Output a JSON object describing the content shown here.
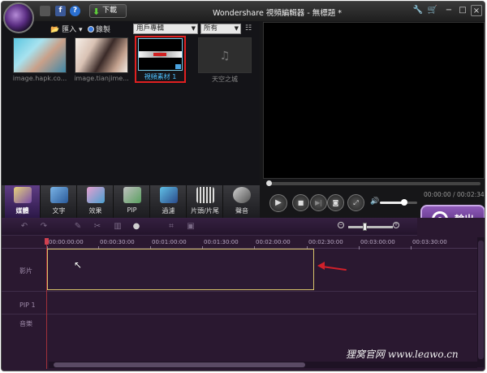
{
  "window": {
    "title": "Wondershare 視頻編輯器 - 無標題 *"
  },
  "titlebar": {
    "facebook_icon": "f",
    "help_icon": "?",
    "download_label": "下載",
    "settings_icon": "wrench-icon",
    "cart_icon": "cart-icon",
    "minimize": "−",
    "maximize": "□",
    "close": "×"
  },
  "library": {
    "import_label": "匯入",
    "record_label": "錄製",
    "album_select": "用戶專輯",
    "filter_select": "所有",
    "items": [
      {
        "caption": "image.hapk.co..."
      },
      {
        "caption": "image.tianjime..."
      },
      {
        "caption": "視頻素材 1",
        "selected": true
      },
      {
        "caption": "天空之城"
      }
    ]
  },
  "tabs": [
    {
      "label": "媒體",
      "active": true
    },
    {
      "label": "文字"
    },
    {
      "label": "效果"
    },
    {
      "label": "PIP"
    },
    {
      "label": "過濾"
    },
    {
      "label": "片頭/片尾"
    },
    {
      "label": "聲音"
    }
  ],
  "player": {
    "timecode": "00:00:00 / 00:02:34",
    "volume_level": 0.65
  },
  "export": {
    "label": "輸出"
  },
  "timeline": {
    "ruler": [
      "00:00:00:00",
      "00:00:30:00",
      "00:01:00:00",
      "00:01:30:00",
      "00:02:00:00",
      "00:02:30:00",
      "00:03:00:00",
      "00:03:30:00"
    ],
    "tracks": [
      "影片",
      "PIP 1",
      "音樂"
    ]
  },
  "watermark": "狸窝官网 www.leawo.cn",
  "colors": {
    "accent": "#5f3d85",
    "selection": "#e02020",
    "clip_border": "#d7c36a",
    "arrow": "#d0202a"
  }
}
